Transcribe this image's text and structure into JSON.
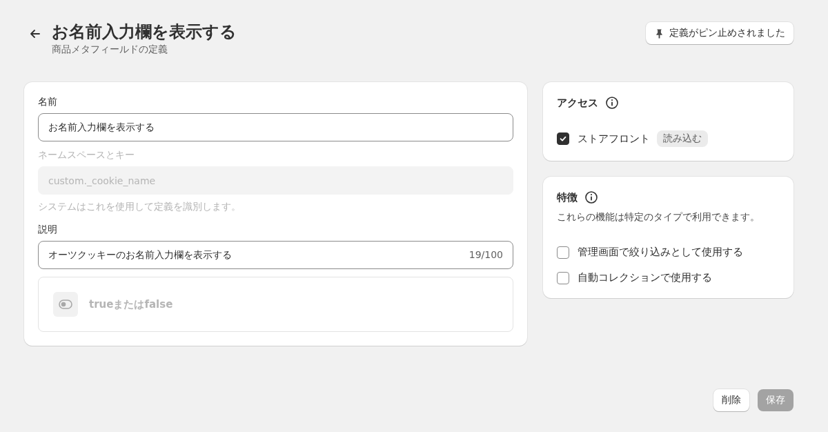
{
  "header": {
    "title": "お名前入力欄を表示する",
    "subtitle": "商品メタフィールドの定義",
    "pin_button": {
      "label": "定義がピン止めされました"
    }
  },
  "definition": {
    "name": {
      "label": "名前",
      "value": "お名前入力欄を表示する"
    },
    "namespace": {
      "label": "ネームスペースとキー",
      "value": "custom._cookie_name",
      "disabled": true,
      "help": "システムはこれを使用して定義を識別します。"
    },
    "description": {
      "label": "説明",
      "value": "オーツクッキーのお名前入力欄を表示する",
      "counter": "19/100"
    },
    "type": {
      "label": "trueまたはfalse",
      "disabled": true
    }
  },
  "access": {
    "title": "アクセス",
    "items": [
      {
        "label": "ストアフロント",
        "checked": true,
        "badge": "読み込む"
      }
    ]
  },
  "features": {
    "title": "特徴",
    "description": "これらの機能は特定のタイプで利用できます。",
    "items": [
      {
        "label": "管理画面で絞り込みとして使用する",
        "checked": false
      },
      {
        "label": "自動コレクションで使用する",
        "checked": false
      }
    ]
  },
  "actions": [
    {
      "label": "削除",
      "disabled": false
    },
    {
      "label": "保存",
      "disabled": true
    }
  ]
}
